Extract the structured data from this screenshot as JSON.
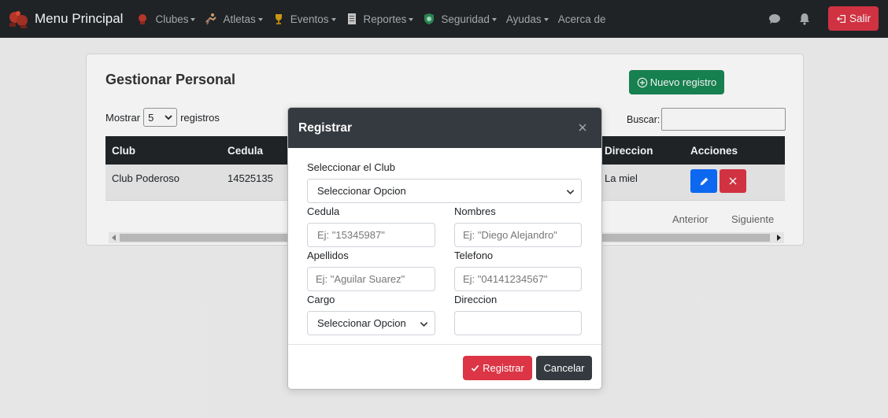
{
  "navbar": {
    "brand": "Menu Principal",
    "items": [
      {
        "label": "Clubes",
        "icon": "boxing-glove-icon"
      },
      {
        "label": "Atletas",
        "icon": "athlete-icon"
      },
      {
        "label": "Eventos",
        "icon": "trophy-icon"
      },
      {
        "label": "Reportes",
        "icon": "document-icon"
      },
      {
        "label": "Seguridad",
        "icon": "shield-icon"
      },
      {
        "label": "Ayudas",
        "icon": ""
      },
      {
        "label": "Acerca de",
        "icon": ""
      }
    ],
    "logout_label": "Salir"
  },
  "card": {
    "title": "Gestionar Personal",
    "new_button": "Nuevo registro",
    "show_label": "Mostrar",
    "show_value": "5",
    "records_label": "registros",
    "search_label": "Buscar:",
    "columns": [
      "Club",
      "Cedula",
      "Direccion",
      "Acciones"
    ],
    "row": {
      "club": "Club Poderoso",
      "cedula": "14525135",
      "direccion": "La miel"
    },
    "prev": "Anterior",
    "next": "Siguiente"
  },
  "modal": {
    "title": "Registrar",
    "club_label": "Seleccionar el Club",
    "club_value": "Seleccionar Opcion",
    "cedula_label": "Cedula",
    "cedula_placeholder": "Ej: \"15345987\"",
    "nombres_label": "Nombres",
    "nombres_placeholder": "Ej: \"Diego Alejandro\"",
    "apellidos_label": "Apellidos",
    "apellidos_placeholder": "Ej: \"Aguilar Suarez\"",
    "telefono_label": "Telefono",
    "telefono_placeholder": "Ej: \"04141234567\"",
    "cargo_label": "Cargo",
    "cargo_value": "Seleccionar Opcion",
    "direccion_label": "Direccion",
    "direccion_value": "",
    "register_button": "Registrar",
    "cancel_button": "Cancelar"
  },
  "colors": {
    "navbar": "#212529",
    "danger": "#dc3545",
    "success": "#198754",
    "primary": "#0d6efd",
    "dark": "#343a40"
  }
}
